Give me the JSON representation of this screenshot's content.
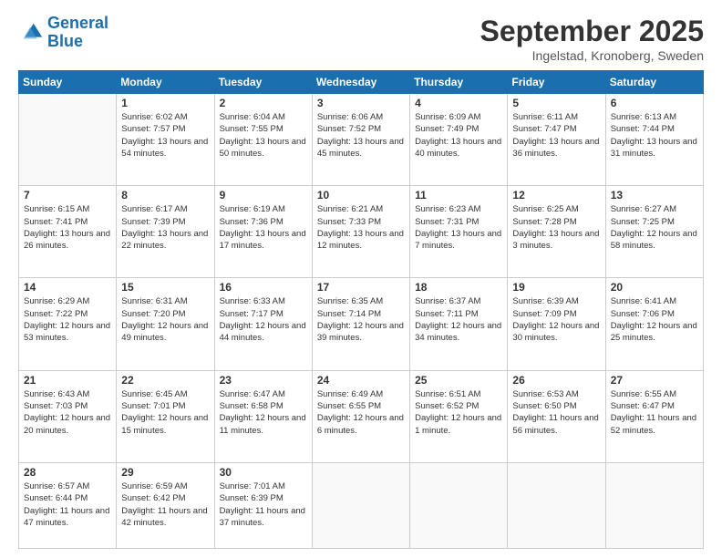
{
  "logo": {
    "line1": "General",
    "line2": "Blue"
  },
  "title": "September 2025",
  "location": "Ingelstad, Kronoberg, Sweden",
  "days": [
    "Sunday",
    "Monday",
    "Tuesday",
    "Wednesday",
    "Thursday",
    "Friday",
    "Saturday"
  ],
  "weeks": [
    [
      {
        "date": "",
        "sunrise": "",
        "sunset": "",
        "daylight": ""
      },
      {
        "date": "1",
        "sunrise": "Sunrise: 6:02 AM",
        "sunset": "Sunset: 7:57 PM",
        "daylight": "Daylight: 13 hours and 54 minutes."
      },
      {
        "date": "2",
        "sunrise": "Sunrise: 6:04 AM",
        "sunset": "Sunset: 7:55 PM",
        "daylight": "Daylight: 13 hours and 50 minutes."
      },
      {
        "date": "3",
        "sunrise": "Sunrise: 6:06 AM",
        "sunset": "Sunset: 7:52 PM",
        "daylight": "Daylight: 13 hours and 45 minutes."
      },
      {
        "date": "4",
        "sunrise": "Sunrise: 6:09 AM",
        "sunset": "Sunset: 7:49 PM",
        "daylight": "Daylight: 13 hours and 40 minutes."
      },
      {
        "date": "5",
        "sunrise": "Sunrise: 6:11 AM",
        "sunset": "Sunset: 7:47 PM",
        "daylight": "Daylight: 13 hours and 36 minutes."
      },
      {
        "date": "6",
        "sunrise": "Sunrise: 6:13 AM",
        "sunset": "Sunset: 7:44 PM",
        "daylight": "Daylight: 13 hours and 31 minutes."
      }
    ],
    [
      {
        "date": "7",
        "sunrise": "Sunrise: 6:15 AM",
        "sunset": "Sunset: 7:41 PM",
        "daylight": "Daylight: 13 hours and 26 minutes."
      },
      {
        "date": "8",
        "sunrise": "Sunrise: 6:17 AM",
        "sunset": "Sunset: 7:39 PM",
        "daylight": "Daylight: 13 hours and 22 minutes."
      },
      {
        "date": "9",
        "sunrise": "Sunrise: 6:19 AM",
        "sunset": "Sunset: 7:36 PM",
        "daylight": "Daylight: 13 hours and 17 minutes."
      },
      {
        "date": "10",
        "sunrise": "Sunrise: 6:21 AM",
        "sunset": "Sunset: 7:33 PM",
        "daylight": "Daylight: 13 hours and 12 minutes."
      },
      {
        "date": "11",
        "sunrise": "Sunrise: 6:23 AM",
        "sunset": "Sunset: 7:31 PM",
        "daylight": "Daylight: 13 hours and 7 minutes."
      },
      {
        "date": "12",
        "sunrise": "Sunrise: 6:25 AM",
        "sunset": "Sunset: 7:28 PM",
        "daylight": "Daylight: 13 hours and 3 minutes."
      },
      {
        "date": "13",
        "sunrise": "Sunrise: 6:27 AM",
        "sunset": "Sunset: 7:25 PM",
        "daylight": "Daylight: 12 hours and 58 minutes."
      }
    ],
    [
      {
        "date": "14",
        "sunrise": "Sunrise: 6:29 AM",
        "sunset": "Sunset: 7:22 PM",
        "daylight": "Daylight: 12 hours and 53 minutes."
      },
      {
        "date": "15",
        "sunrise": "Sunrise: 6:31 AM",
        "sunset": "Sunset: 7:20 PM",
        "daylight": "Daylight: 12 hours and 49 minutes."
      },
      {
        "date": "16",
        "sunrise": "Sunrise: 6:33 AM",
        "sunset": "Sunset: 7:17 PM",
        "daylight": "Daylight: 12 hours and 44 minutes."
      },
      {
        "date": "17",
        "sunrise": "Sunrise: 6:35 AM",
        "sunset": "Sunset: 7:14 PM",
        "daylight": "Daylight: 12 hours and 39 minutes."
      },
      {
        "date": "18",
        "sunrise": "Sunrise: 6:37 AM",
        "sunset": "Sunset: 7:11 PM",
        "daylight": "Daylight: 12 hours and 34 minutes."
      },
      {
        "date": "19",
        "sunrise": "Sunrise: 6:39 AM",
        "sunset": "Sunset: 7:09 PM",
        "daylight": "Daylight: 12 hours and 30 minutes."
      },
      {
        "date": "20",
        "sunrise": "Sunrise: 6:41 AM",
        "sunset": "Sunset: 7:06 PM",
        "daylight": "Daylight: 12 hours and 25 minutes."
      }
    ],
    [
      {
        "date": "21",
        "sunrise": "Sunrise: 6:43 AM",
        "sunset": "Sunset: 7:03 PM",
        "daylight": "Daylight: 12 hours and 20 minutes."
      },
      {
        "date": "22",
        "sunrise": "Sunrise: 6:45 AM",
        "sunset": "Sunset: 7:01 PM",
        "daylight": "Daylight: 12 hours and 15 minutes."
      },
      {
        "date": "23",
        "sunrise": "Sunrise: 6:47 AM",
        "sunset": "Sunset: 6:58 PM",
        "daylight": "Daylight: 12 hours and 11 minutes."
      },
      {
        "date": "24",
        "sunrise": "Sunrise: 6:49 AM",
        "sunset": "Sunset: 6:55 PM",
        "daylight": "Daylight: 12 hours and 6 minutes."
      },
      {
        "date": "25",
        "sunrise": "Sunrise: 6:51 AM",
        "sunset": "Sunset: 6:52 PM",
        "daylight": "Daylight: 12 hours and 1 minute."
      },
      {
        "date": "26",
        "sunrise": "Sunrise: 6:53 AM",
        "sunset": "Sunset: 6:50 PM",
        "daylight": "Daylight: 11 hours and 56 minutes."
      },
      {
        "date": "27",
        "sunrise": "Sunrise: 6:55 AM",
        "sunset": "Sunset: 6:47 PM",
        "daylight": "Daylight: 11 hours and 52 minutes."
      }
    ],
    [
      {
        "date": "28",
        "sunrise": "Sunrise: 6:57 AM",
        "sunset": "Sunset: 6:44 PM",
        "daylight": "Daylight: 11 hours and 47 minutes."
      },
      {
        "date": "29",
        "sunrise": "Sunrise: 6:59 AM",
        "sunset": "Sunset: 6:42 PM",
        "daylight": "Daylight: 11 hours and 42 minutes."
      },
      {
        "date": "30",
        "sunrise": "Sunrise: 7:01 AM",
        "sunset": "Sunset: 6:39 PM",
        "daylight": "Daylight: 11 hours and 37 minutes."
      },
      {
        "date": "",
        "sunrise": "",
        "sunset": "",
        "daylight": ""
      },
      {
        "date": "",
        "sunrise": "",
        "sunset": "",
        "daylight": ""
      },
      {
        "date": "",
        "sunrise": "",
        "sunset": "",
        "daylight": ""
      },
      {
        "date": "",
        "sunrise": "",
        "sunset": "",
        "daylight": ""
      }
    ]
  ]
}
